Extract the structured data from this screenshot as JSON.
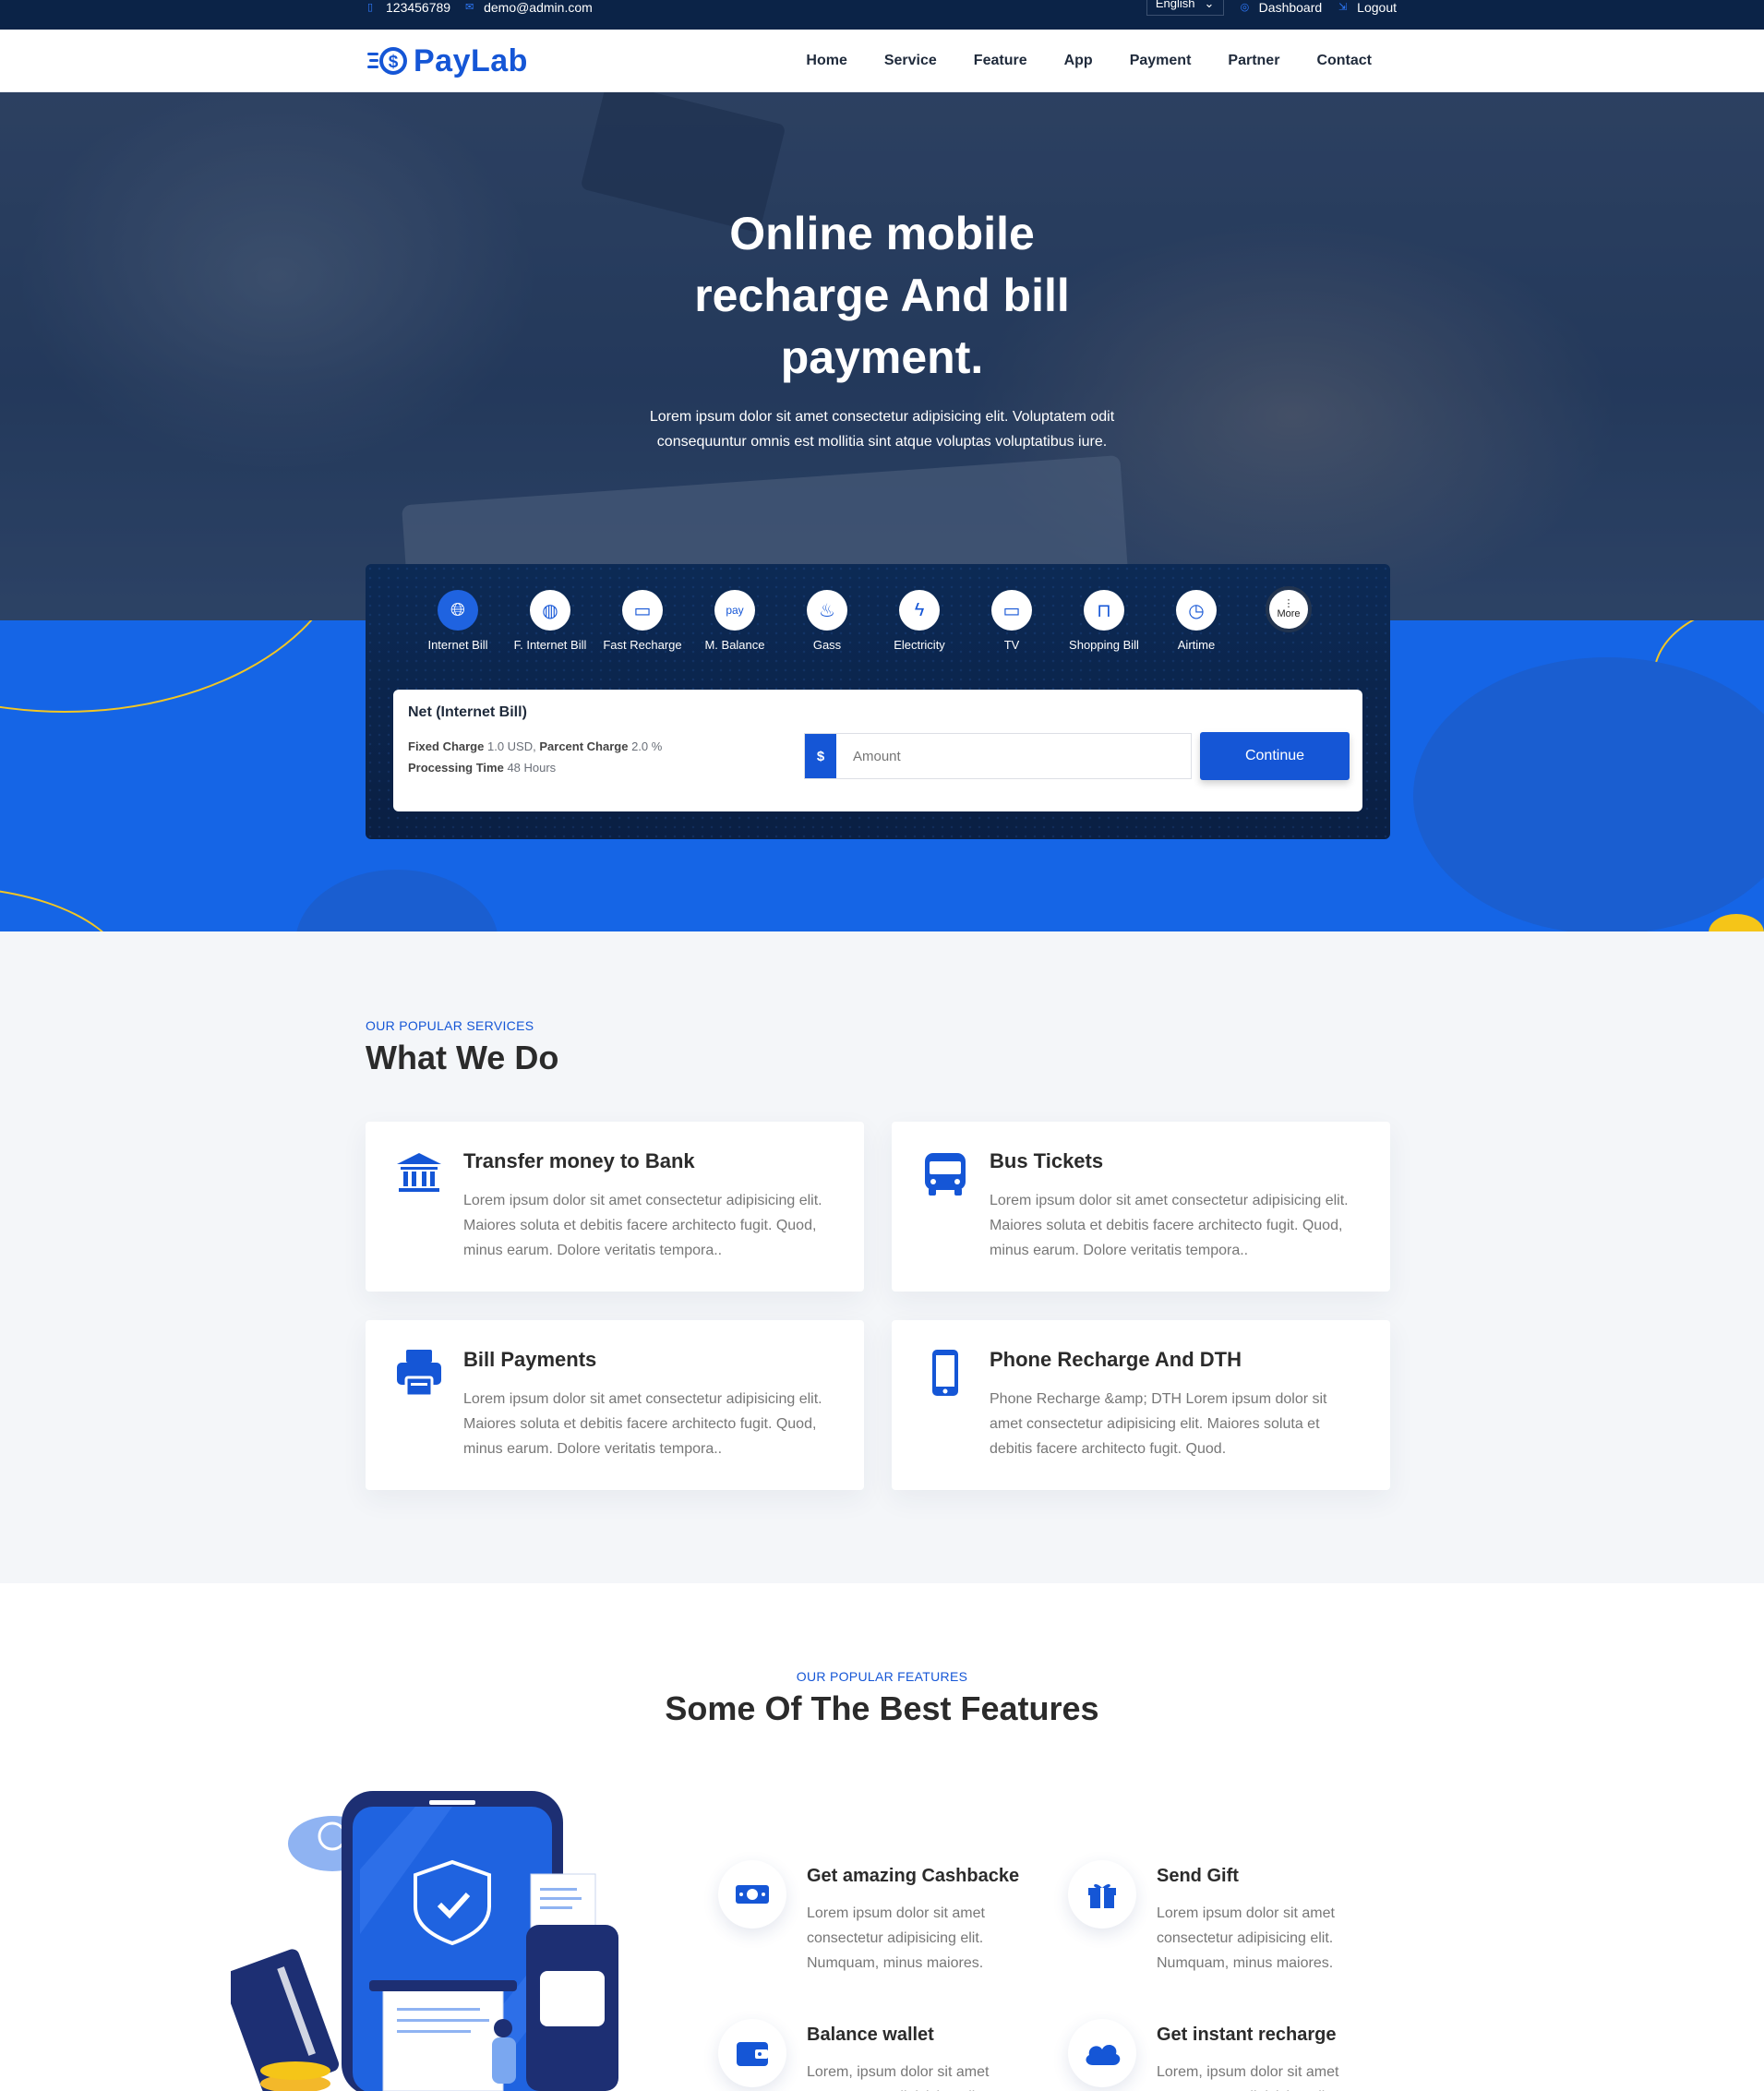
{
  "topbar": {
    "phone": "123456789",
    "email": "demo@admin.com",
    "language": "English",
    "dashboard": "Dashboard",
    "logout": "Logout"
  },
  "brand": {
    "name": "PayLab",
    "color": "#1556d6"
  },
  "nav": [
    "Home",
    "Service",
    "Feature",
    "App",
    "Payment",
    "Partner",
    "Contact"
  ],
  "hero": {
    "title": "Online mobile recharge And bill payment.",
    "subtitle": "Lorem ipsum dolor sit amet consectetur adipisicing elit. Voluptatem odit consequuntur omnis est mollitia sint atque voluptas voluptatibus iure."
  },
  "services": [
    {
      "label": "Internet Bill",
      "icon": "globe-icon",
      "active": true
    },
    {
      "label": "F. Internet Bill",
      "icon": "globe-icon"
    },
    {
      "label": "Fast Recharge",
      "icon": "money-icon"
    },
    {
      "label": "M. Balance",
      "icon": "pay-icon"
    },
    {
      "label": "Gass",
      "icon": "flame-icon"
    },
    {
      "label": "Electricity",
      "icon": "electricity-icon"
    },
    {
      "label": "TV",
      "icon": "tv-icon"
    },
    {
      "label": "Shopping Bill",
      "icon": "shopping-bag-icon"
    },
    {
      "label": "Airtime",
      "icon": "stopwatch-icon"
    }
  ],
  "more_label": "More",
  "recharge_form": {
    "title": "Net (Internet Bill)",
    "fixed_charge_label": "Fixed Charge",
    "fixed_charge_value": "1.0 USD,",
    "percent_charge_label": "Parcent Charge",
    "percent_charge_value": "2.0 %",
    "processing_label": "Processing Time",
    "processing_value": "48 Hours",
    "currency": "$",
    "amount_placeholder": "Amount",
    "continue_label": "Continue"
  },
  "what_we_do": {
    "kicker": "OUR POPULAR SERVICES",
    "title": "What We Do",
    "cards": [
      {
        "title": "Transfer money to Bank",
        "text": "Lorem ipsum dolor sit amet consectetur adipisicing elit. Maiores soluta et debitis facere architecto fugit. Quod, minus earum. Dolore veritatis tempora..",
        "icon": "bank-icon"
      },
      {
        "title": "Bus Tickets",
        "text": "Lorem ipsum dolor sit amet consectetur adipisicing elit. Maiores soluta et debitis facere architecto fugit. Quod, minus earum. Dolore veritatis tempora..",
        "icon": "bus-icon"
      },
      {
        "title": "Bill Payments",
        "text": "Lorem ipsum dolor sit amet consectetur adipisicing elit. Maiores soluta et debitis facere architecto fugit. Quod, minus earum. Dolore veritatis tempora..",
        "icon": "printer-icon"
      },
      {
        "title": "Phone Recharge And DTH",
        "text": "Phone Recharge &amp; DTH Lorem ipsum dolor sit amet consectetur adipisicing elit. Maiores soluta et debitis facere architecto fugit. Quod.",
        "icon": "mobile-icon"
      }
    ]
  },
  "features": {
    "kicker": "OUR POPULAR FEATURES",
    "title": "Some Of The Best Features",
    "items": [
      {
        "title": "Get amazing Cashbacke",
        "text": "Lorem ipsum dolor sit amet consectetur adipisicing elit. Numquam, minus maiores.",
        "icon": "cash-icon"
      },
      {
        "title": "Send Gift",
        "text": "Lorem ipsum dolor sit amet consectetur adipisicing elit. Numquam, minus maiores.",
        "icon": "gift-icon"
      },
      {
        "title": "Balance wallet",
        "text": "Lorem, ipsum dolor sit amet consectetur adipisicing elit.",
        "icon": "wallet-icon"
      },
      {
        "title": "Get instant recharge",
        "text": "Lorem, ipsum dolor sit amet consectetur adipisicing elit.",
        "icon": "cloud-icon"
      }
    ]
  }
}
